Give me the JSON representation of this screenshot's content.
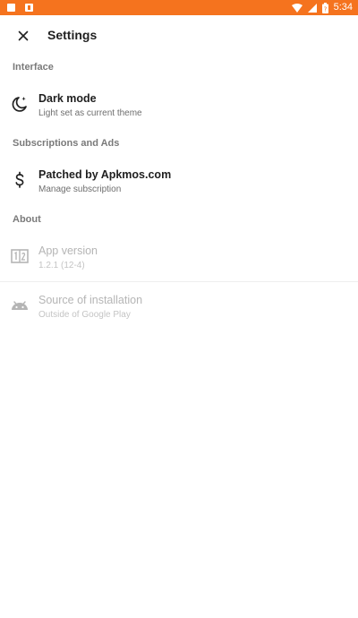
{
  "status_bar": {
    "time": "5:34",
    "battery_icon": "battery-icon",
    "wifi_icon": "wifi-icon",
    "signal_icon": "signal-icon"
  },
  "app_bar": {
    "title": "Settings",
    "close_icon": "close-icon"
  },
  "sections": {
    "interface": {
      "header": "Interface"
    },
    "subscriptions": {
      "header": "Subscriptions and Ads"
    },
    "about": {
      "header": "About"
    }
  },
  "items": {
    "dark_mode": {
      "title": "Dark mode",
      "subtitle": "Light set as current theme",
      "icon": "moon-icon"
    },
    "subscription": {
      "title": "Patched by Apkmos.com",
      "subtitle": "Manage subscription",
      "icon": "dollar-icon"
    },
    "app_version": {
      "title": "App version",
      "subtitle": "1.2.1 (12-4)",
      "icon": "version-icon"
    },
    "source": {
      "title": "Source of installation",
      "subtitle": "Outside of Google Play",
      "icon": "android-icon"
    }
  },
  "colors": {
    "status_bar": "#F5731E",
    "section_header": "#7a7a7a",
    "disabled_text": "#b5b5b5"
  }
}
